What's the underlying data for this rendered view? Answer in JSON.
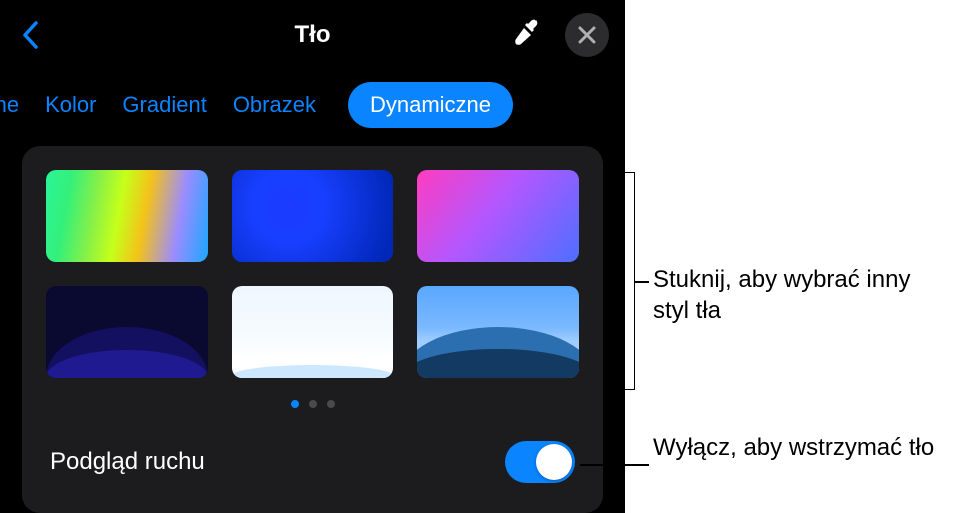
{
  "header": {
    "title": "Tło"
  },
  "tabs": {
    "items": [
      "tępne",
      "Kolor",
      "Gradient",
      "Obrazek",
      "Dynamiczne"
    ],
    "activeIndex": 4
  },
  "motion": {
    "label": "Podgląd ruchu",
    "on": true
  },
  "paging": {
    "count": 3,
    "active": 0
  },
  "callouts": {
    "grid": "Stuknij, aby wybrać inny styl tła",
    "toggle": "Wyłącz, aby wstrzymać tło"
  }
}
